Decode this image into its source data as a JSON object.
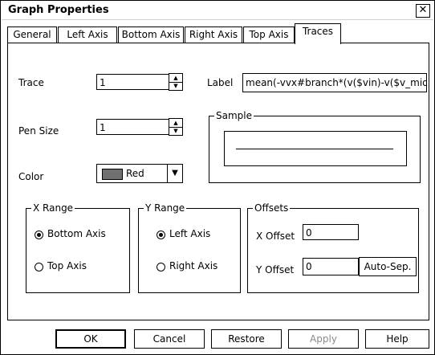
{
  "window": {
    "title": "Graph Properties",
    "close_glyph": "✕"
  },
  "tabs": [
    {
      "label": "General"
    },
    {
      "label": "Left Axis"
    },
    {
      "label": "Bottom Axis"
    },
    {
      "label": "Right Axis"
    },
    {
      "label": "Top Axis"
    },
    {
      "label": "Traces",
      "selected": true
    }
  ],
  "trace": {
    "trace_label": "Trace",
    "trace_value": "1",
    "pen_size_label": "Pen Size",
    "pen_size_value": "1",
    "color_label": "Color",
    "color_value": "Red",
    "color_swatch": "#707070",
    "label_label": "Label",
    "label_value": "mean(-vvx#branch*(v($vin)-v($v_mid)))",
    "sample_label": "Sample"
  },
  "x_range": {
    "title": "X Range",
    "options": [
      {
        "label": "Bottom Axis",
        "selected": true
      },
      {
        "label": "Top Axis",
        "selected": false
      }
    ]
  },
  "y_range": {
    "title": "Y Range",
    "options": [
      {
        "label": "Left Axis",
        "selected": true
      },
      {
        "label": "Right Axis",
        "selected": false
      }
    ]
  },
  "offsets": {
    "title": "Offsets",
    "x_offset_label": "X Offset",
    "x_offset_value": "0",
    "y_offset_label": "Y Offset",
    "y_offset_value": "0",
    "auto_sep_label": "Auto-Sep."
  },
  "buttons": {
    "ok": "OK",
    "cancel": "Cancel",
    "restore": "Restore",
    "apply": "Apply",
    "help": "Help"
  }
}
